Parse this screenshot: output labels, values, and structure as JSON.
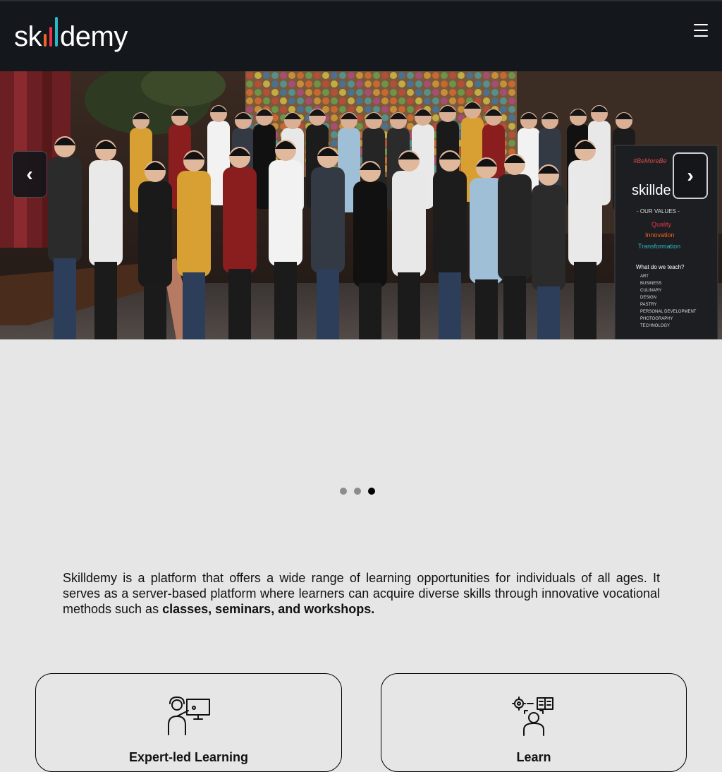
{
  "header": {
    "logo_text_start": "sk",
    "logo_text_end": "demy",
    "logo_bar_colors": [
      "#f26522",
      "#e8334a",
      "#2bb8c9"
    ],
    "menu_icon": "hamburger-menu-icon"
  },
  "hero": {
    "prev_label": "‹",
    "next_label": "›",
    "banner": {
      "hashtag": "#BeMoreBe",
      "brand": "skillde",
      "values_heading": "- OUR VALUES -",
      "values": [
        "Quality",
        "Innovation",
        "Transformation"
      ],
      "teach_heading": "What do we teach?",
      "subjects": [
        "ART",
        "BUSINESS",
        "CULINARY",
        "DESIGN",
        "PASTRY",
        "PERSONAL DEVELOPMENT",
        "PHOTOGRAPHY",
        "TECHNOLOGY"
      ]
    }
  },
  "carousel": {
    "slide_count": 3,
    "active_index": 2
  },
  "intro": {
    "text": "Skilldemy is a platform that offers a wide range of learning opportunities for individuals of all ages. It serves as a server-based platform where learners can acquire diverse skills through innovative vocational methods such as ",
    "bold_text": "classes, seminars, and workshops."
  },
  "features": [
    {
      "icon": "teacher-presentation-icon",
      "title": "Expert-led Learning"
    },
    {
      "icon": "learner-skills-icon",
      "title": "Learn"
    }
  ],
  "colors": {
    "topbar": "#14171c",
    "page_background": "#e6e6e6",
    "dot_inactive": "#8c8c8c",
    "dot_active": "#000000"
  }
}
